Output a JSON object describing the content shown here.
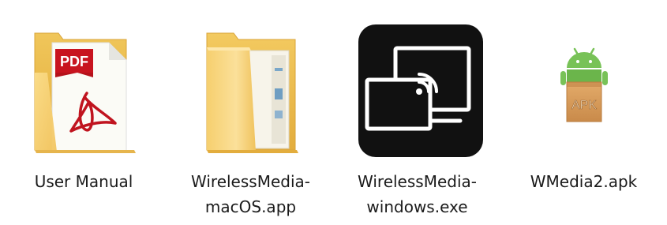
{
  "files": [
    {
      "name": "User Manual",
      "icon": "pdf-folder-icon"
    },
    {
      "name": "WirelessMedia-\nmacOS.app",
      "icon": "folder-icon"
    },
    {
      "name": "WirelessMedia-\nwindows.exe",
      "icon": "screen-cast-app-icon"
    },
    {
      "name": "WMedia2.apk",
      "icon": "android-apk-icon"
    }
  ],
  "colors": {
    "folder_back": "#e9b646",
    "folder_front": "#f9d57a",
    "pdf_red": "#b5121b",
    "app_tile": "#111111",
    "android_green": "#78c257",
    "apk_box": "#d59a5b"
  }
}
